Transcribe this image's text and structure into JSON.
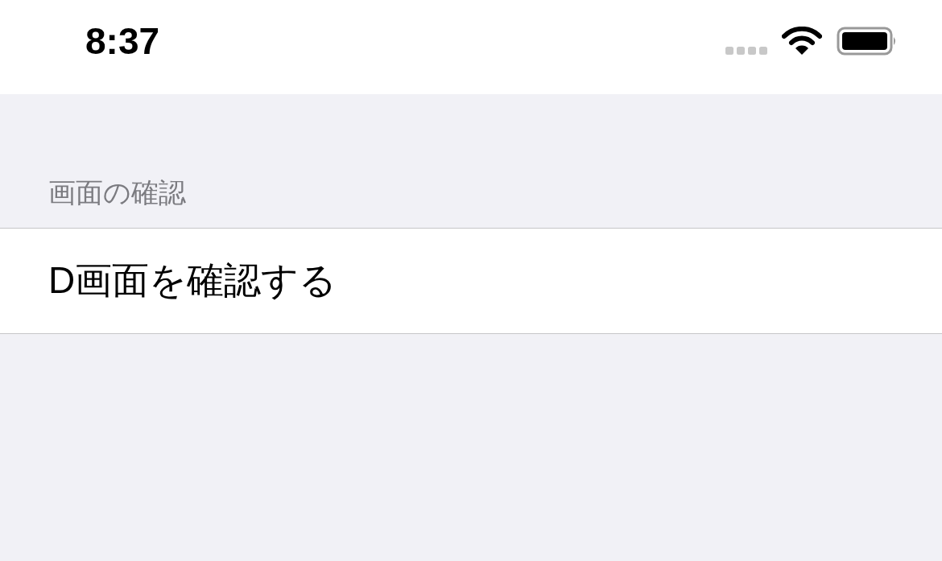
{
  "status_bar": {
    "time": "8:37"
  },
  "section": {
    "header": "画面の確認",
    "rows": [
      {
        "label": "D画面を確認する"
      }
    ]
  }
}
